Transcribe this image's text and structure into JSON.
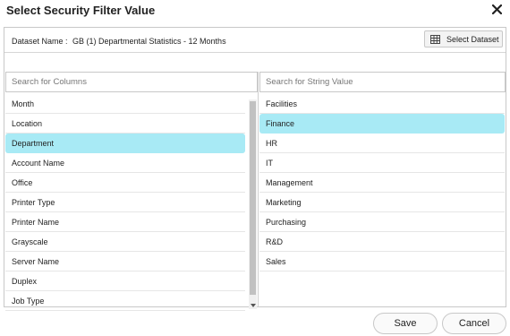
{
  "dialog": {
    "title": "Select Security Filter Value"
  },
  "dataset": {
    "label": "Dataset Name :",
    "value": "GB (1) Departmental Statistics - 12 Months",
    "button_label": "Select Dataset"
  },
  "columns": {
    "search_placeholder": "Search for Columns",
    "items": [
      "Month",
      "Location",
      "Department",
      "Account Name",
      "Office",
      "Printer Type",
      "Printer Name",
      "Grayscale",
      "Server Name",
      "Duplex",
      "Job Type"
    ],
    "selected": "Department"
  },
  "values": {
    "search_placeholder": "Search for String Value",
    "items": [
      "Facilities",
      "Finance",
      "HR",
      "IT",
      "Management",
      "Marketing",
      "Purchasing",
      "R&D",
      "Sales"
    ],
    "selected": "Finance"
  },
  "footer": {
    "save_label": "Save",
    "cancel_label": "Cancel"
  },
  "colors": {
    "selected_bg": "#a8eaf5",
    "border": "#c8c8c8"
  }
}
